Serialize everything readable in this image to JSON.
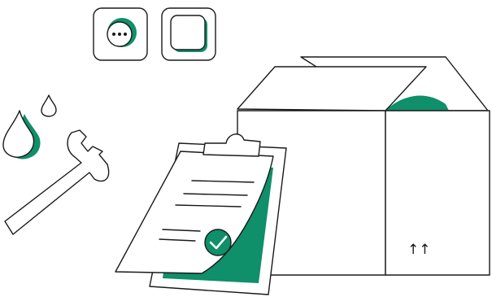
{
  "scene": {
    "description_icons": [
      "power-socket-icon",
      "light-switch-icon",
      "water-drop-icon",
      "wrench-icon",
      "shipping-box-icon",
      "clipboard-checklist-icon",
      "checkmark-icon"
    ],
    "box": {
      "this_side_up_marking": "↑↑"
    },
    "colors": {
      "accent": "#0f8f6a",
      "outline": "#1a1a1a",
      "background": "#ffffff"
    }
  }
}
